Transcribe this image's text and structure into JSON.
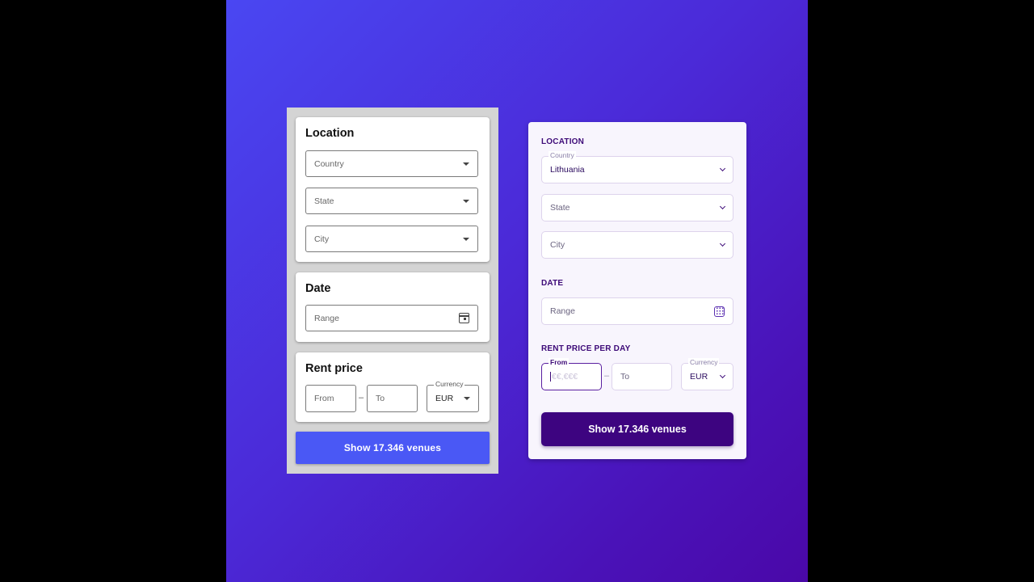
{
  "material": {
    "location": {
      "title": "Location",
      "country": "Country",
      "state": "State",
      "city": "City"
    },
    "date": {
      "title": "Date",
      "range": "Range"
    },
    "price": {
      "title": "Rent price",
      "from": "From",
      "to": "To",
      "currency_label": "Currency",
      "currency_value": "EUR"
    },
    "button": "Show 17.346 venues"
  },
  "custom": {
    "location": {
      "title": "LOCATION",
      "country_label": "Country",
      "country_value": "Lithuania",
      "state": "State",
      "city": "City"
    },
    "date": {
      "title": "DATE",
      "range": "Range"
    },
    "price": {
      "title": "RENT PRICE PER DAY",
      "from_label": "From",
      "from_placeholder": "€€,€€€",
      "to": "To",
      "currency_label": "Currency",
      "currency_value": "EUR"
    },
    "button": "Show 17.346 venues"
  },
  "colors": {
    "material_accent": "#4a58f5",
    "custom_accent": "#3d0480",
    "background_start": "#4a47f2",
    "background_end": "#4a08a8"
  },
  "icons": {
    "dropdown": "caret-down-icon",
    "calendar": "calendar-icon",
    "chevron": "chevron-down-icon"
  }
}
